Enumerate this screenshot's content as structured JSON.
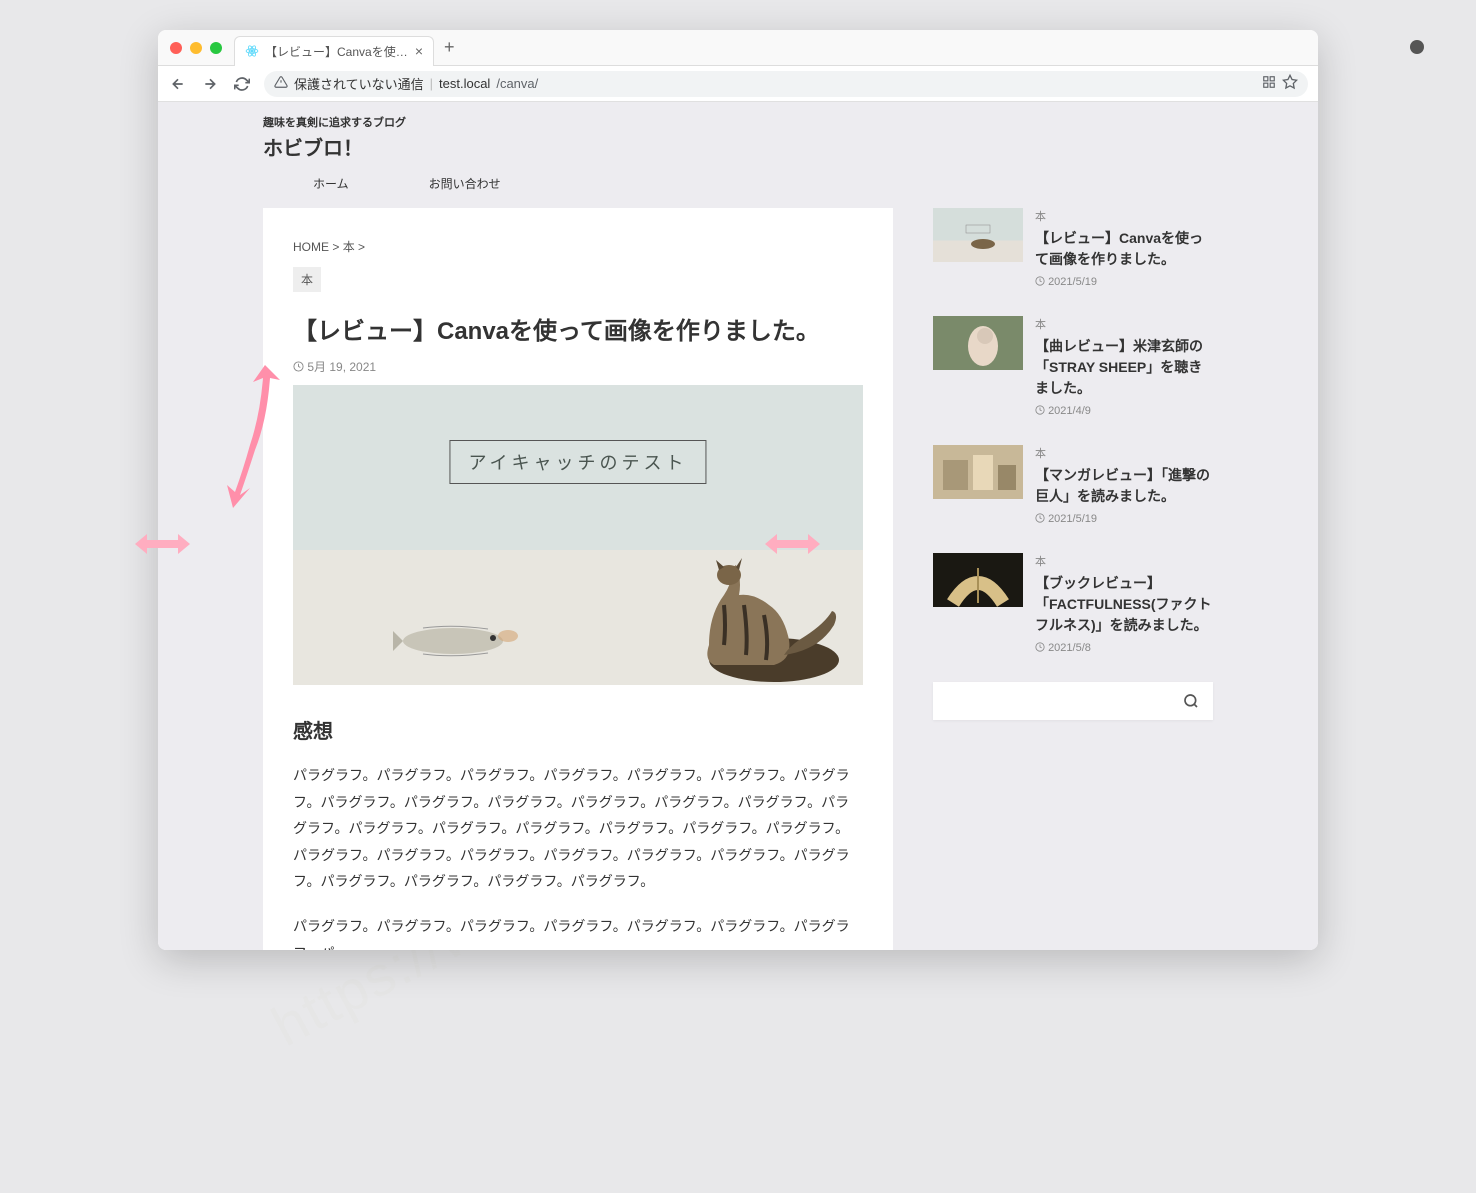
{
  "browser": {
    "tab_title": "【レビュー】Canvaを使って画像",
    "address_warning": "保護されていない通信",
    "address_host": "test.local",
    "address_path": "/canva/"
  },
  "site": {
    "tagline": "趣味を真剣に追求するブログ",
    "title": "ホビブロ！",
    "nav": {
      "home": "ホーム",
      "contact": "お問い合わせ"
    }
  },
  "breadcrumb": {
    "home": "HOME",
    "sep1": " > ",
    "cat": "本",
    "sep2": " >"
  },
  "article": {
    "category_tag": "本",
    "title": "【レビュー】Canvaを使って画像を作りました。",
    "date": "5月 19, 2021",
    "eyecatch_text": "アイキャッチのテスト",
    "heading1": "感想",
    "para1": "パラグラフ。パラグラフ。パラグラフ。パラグラフ。パラグラフ。パラグラフ。パラグラフ。パラグラフ。パラグラフ。パラグラフ。パラグラフ。パラグラフ。パラグラフ。パラグラフ。パラグラフ。パラグラフ。パラグラフ。パラグラフ。パラグラフ。パラグラフ。パラグラフ。パラグラフ。パラグラフ。パラグラフ。パラグラフ。パラグラフ。パラグラフ。パラグラフ。パラグラフ。パラグラフ。パラグラフ。",
    "para2": "パラグラフ。パラグラフ。パラグラフ。パラグラフ。パラグラフ。パラグラフ。パラグラフ。パ"
  },
  "sidebar_items": [
    {
      "cat": "本",
      "title": "【レビュー】Canvaを使って画像を作りました。",
      "date": "2021/5/19",
      "thumb": "eyecatch"
    },
    {
      "cat": "本",
      "title": "【曲レビュー】米津玄師の「STRAY SHEEP」を聴きました。",
      "date": "2021/4/9",
      "thumb": "woman"
    },
    {
      "cat": "本",
      "title": "【マンガレビュー】「進撃の巨人」を読みました。",
      "date": "2021/5/19",
      "thumb": "crowd"
    },
    {
      "cat": "本",
      "title": "【ブックレビュー】「FACTFULNESS(ファクトフルネス)」を読みました。",
      "date": "2021/5/8",
      "thumb": "book"
    }
  ],
  "watermark": "https://wordpress-theme.jp/affinger/"
}
